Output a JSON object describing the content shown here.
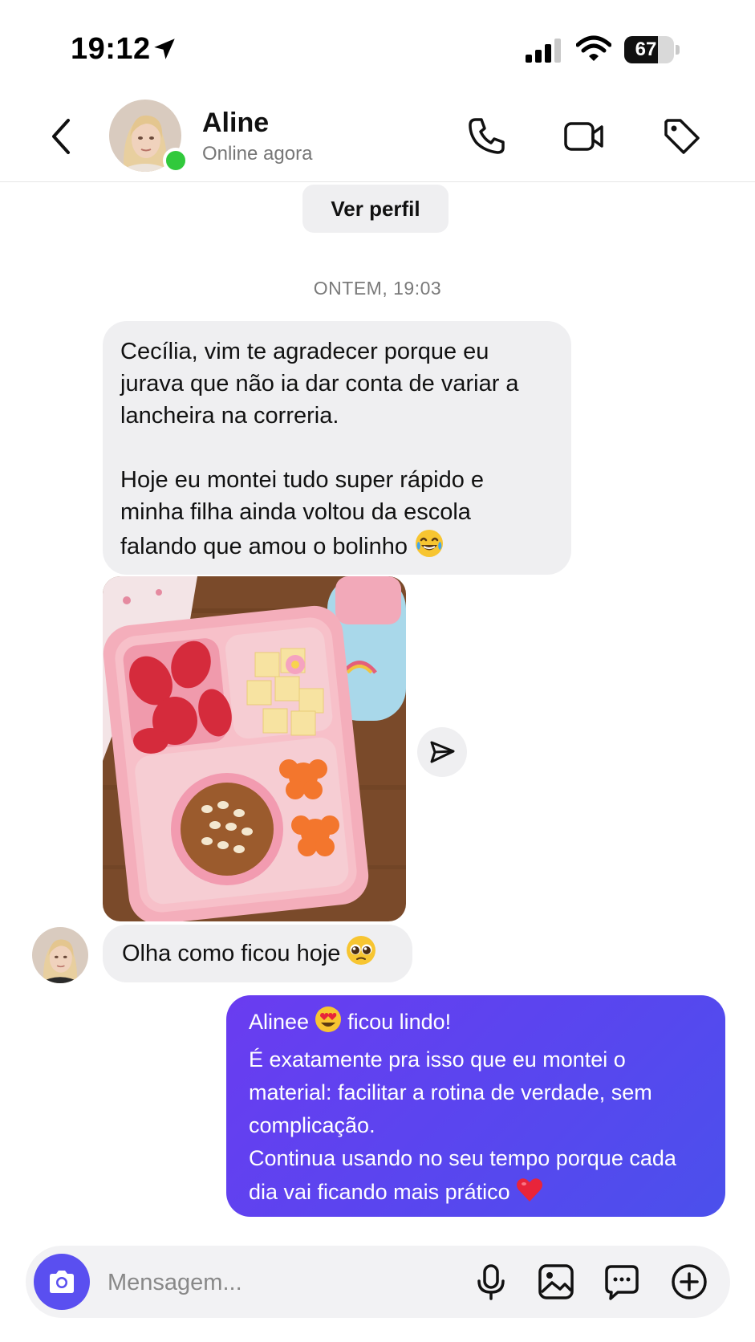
{
  "status_bar": {
    "time": "19:12",
    "battery": "67",
    "battery_level": 0.67
  },
  "header": {
    "contact_name": "Aline",
    "status": "Online agora",
    "icons": [
      "back-chevron-icon",
      "phone-icon",
      "video-camera-icon",
      "tag-icon"
    ]
  },
  "view_profile_label": "Ver perfil",
  "date_divider": "ONTEM, 19:03",
  "messages": {
    "incoming_1": {
      "paragraph_1": "Cecília, vim te agradecer porque eu jurava que não ia dar conta de variar a lancheira na correria.",
      "paragraph_2": "Hoje eu montei tudo super rápido e minha filha ainda voltou da escola falando que amou o bolinho",
      "emoji": "😂"
    },
    "incoming_2": {
      "text": "Olha como ficou hoje",
      "emoji": "🥹"
    },
    "outgoing": {
      "line_1a": "Alinee",
      "line_1_emoji": "😍",
      "line_1b": "ficou lindo!",
      "line_2": "É exatamente pra isso que eu montei o",
      "line_3": "material: facilitar a rotina de verdade, sem",
      "line_4": "complicação.",
      "line_5": "Continua usando no seu tempo porque cada",
      "line_6": "dia vai ficando mais prático",
      "line_6_emoji": "❤️"
    }
  },
  "composer": {
    "placeholder": "Mensagem...",
    "icons": [
      "camera-icon",
      "microphone-icon",
      "gallery-icon",
      "sticker-icon",
      "plus-circle-icon"
    ]
  },
  "colors": {
    "accent": "#5a4ff0",
    "bubble_in": "#efeff1",
    "online": "#31c93c"
  }
}
